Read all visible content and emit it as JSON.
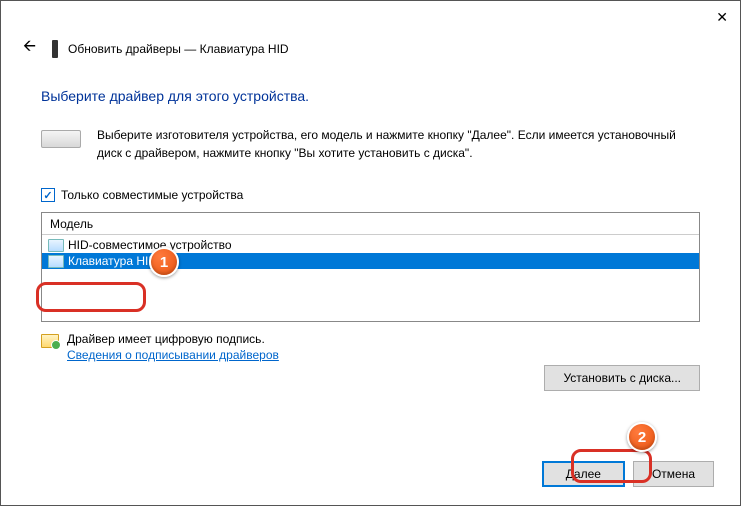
{
  "header": {
    "title": "Обновить драйверы — Клавиатура HID"
  },
  "page": {
    "title": "Выберите драйвер для этого устройства.",
    "instruction": "Выберите изготовителя устройства, его модель и нажмите кнопку \"Далее\". Если имеется установочный диск с драйвером, нажмите кнопку \"Вы хотите установить с диска\"."
  },
  "checkbox": {
    "label": "Только совместимые устройства"
  },
  "model": {
    "header": "Модель",
    "items": [
      "HID-совместимое устройство",
      "Клавиатура HID"
    ]
  },
  "signed": {
    "title": "Драйвер имеет цифровую подпись.",
    "link": "Сведения о подписывании драйверов"
  },
  "buttons": {
    "install_disk": "Установить с диска...",
    "next": "Далее",
    "cancel": "Отмена"
  },
  "badges": {
    "b1": "1",
    "b2": "2"
  }
}
